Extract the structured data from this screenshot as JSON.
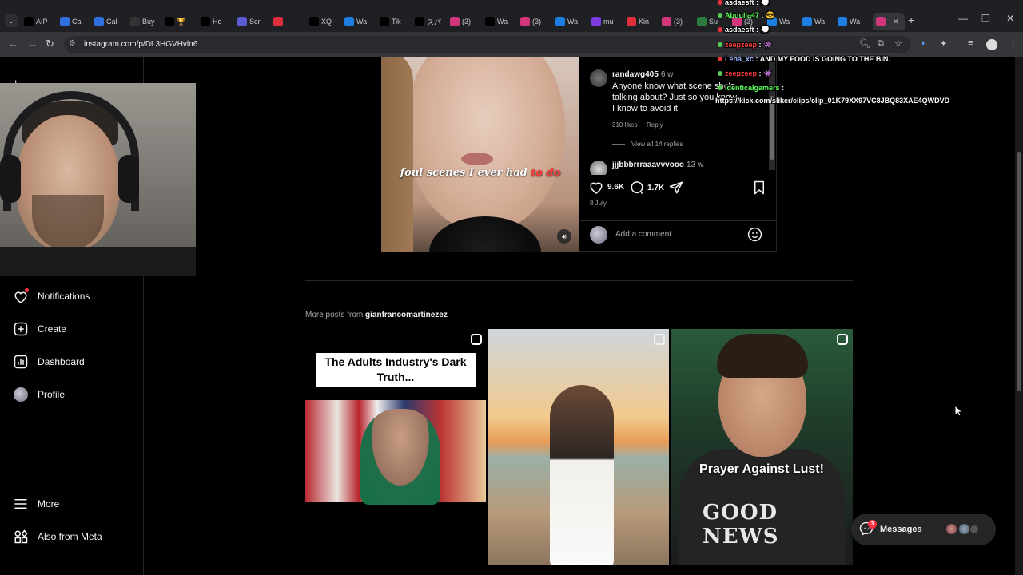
{
  "browser": {
    "tabs": [
      {
        "label": "AIP",
        "color": "#000"
      },
      {
        "label": "Cal",
        "color": "#2f6fe0"
      },
      {
        "label": "Cal",
        "color": "#2f6fe0"
      },
      {
        "label": "Buy",
        "color": "#333"
      },
      {
        "label": "🏆",
        "color": "#000"
      },
      {
        "label": "Ho",
        "color": "#000"
      },
      {
        "label": "Scr",
        "color": "#5b5bd6"
      },
      {
        "label": "",
        "color": "#e02d3c"
      },
      {
        "label": "XQ",
        "color": "#000"
      },
      {
        "label": "Wa",
        "color": "#1d7de0"
      },
      {
        "label": "Tik",
        "color": "#000"
      },
      {
        "label": "スパ",
        "color": "#000"
      },
      {
        "label": "(3)",
        "color": "#d3357c"
      },
      {
        "label": "Wa",
        "color": "#000"
      },
      {
        "label": "(3)",
        "color": "#d3357c"
      },
      {
        "label": "Wa",
        "color": "#1d7de0"
      },
      {
        "label": "mu",
        "color": "#7d3ce0"
      },
      {
        "label": "Kin",
        "color": "#e02d3c"
      },
      {
        "label": "(3)",
        "color": "#d3357c"
      },
      {
        "label": "Su",
        "color": "#2c7a3c"
      },
      {
        "label": "(3)",
        "color": "#d3357c"
      },
      {
        "label": "Wa",
        "color": "#1d7de0"
      },
      {
        "label": "Wa",
        "color": "#1d7de0"
      },
      {
        "label": "Wa",
        "color": "#1d7de0"
      }
    ],
    "url": "instagram.com/p/DL3HGVHvln6"
  },
  "sidebar": {
    "logo_fragment": "I ",
    "items": [
      {
        "label": "Notifications"
      },
      {
        "label": "Create"
      },
      {
        "label": "Dashboard"
      },
      {
        "label": "Profile"
      },
      {
        "label": "More"
      },
      {
        "label": "Also from Meta"
      }
    ]
  },
  "post": {
    "caption_main": "foul scenes I ever had ",
    "caption_highlight": "to do",
    "comments": [
      {
        "user": "randawg405",
        "time": "6 w",
        "text": "Anyone know what scene she's talking about? Just so you know, I know to avoid it",
        "likes": "310 likes",
        "reply": "Reply",
        "view_replies": "View all 14 replies"
      },
      {
        "user": "jjjbbbrrraaavvvooo",
        "time": "13 w"
      }
    ],
    "likes": "9.6K",
    "comment_count": "1.7K",
    "date": "8 July",
    "add_comment_placeholder": "Add a comment..."
  },
  "more_posts": {
    "prefix": "More posts from ",
    "username": "gianfrancomartinezez",
    "tiles": [
      {
        "text": "The Adults Industry's Dark Truth..."
      },
      {
        "text": ""
      },
      {
        "text": "Prayer Against Lust!",
        "shirt": "GOOD NEWS"
      }
    ]
  },
  "messages": {
    "label": "Messages",
    "badge": "3"
  },
  "chat": [
    {
      "user": "asdaesft",
      "color": "#ff5555",
      "msg": ""
    },
    {
      "user": "Abdulla47",
      "color": "#5cff5c",
      "msg": ""
    },
    {
      "user": "asdaesft",
      "color": "#ff5555",
      "msg": ""
    },
    {
      "user": "zeepzeep",
      "color": "#ff3b3b",
      "msg": ""
    },
    {
      "user": "Lena_xc",
      "color": "#7d9bff",
      "msg": "AND MY FOOD IS GOING TO THE BIN."
    },
    {
      "user": "zeepzeep",
      "color": "#ff3b3b",
      "msg": ""
    },
    {
      "user": "identicalgamers",
      "color": "#5cff5c",
      "msg": ""
    },
    {
      "user": "",
      "color": "#fff",
      "msg": "https://kick.com/sliker/clips/clip_01K79XX97VC8JBQ83XAE4QWDVD"
    }
  ]
}
